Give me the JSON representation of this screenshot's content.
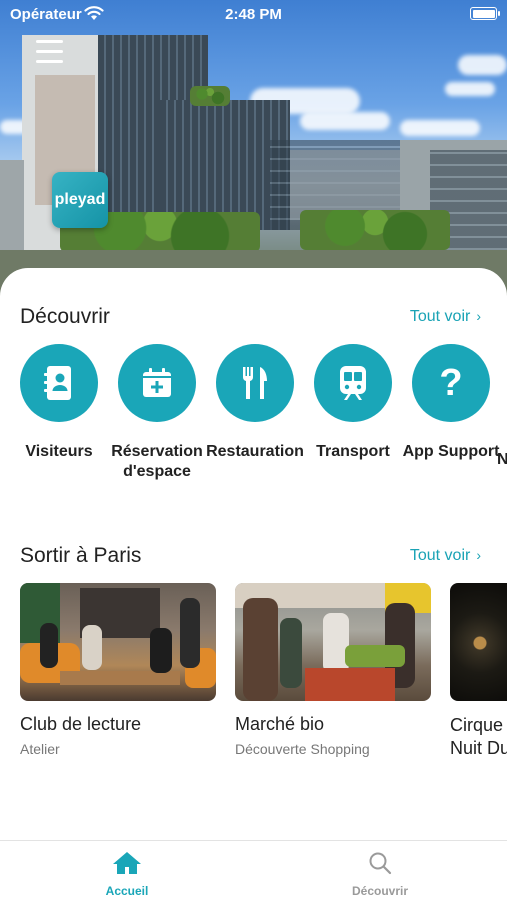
{
  "status_bar": {
    "carrier": "Opérateur",
    "time": "2:48 PM"
  },
  "brand": {
    "logo_text": "pleyad",
    "accent": "#1aa6b8"
  },
  "discover": {
    "title": "Découvrir",
    "see_all": "Tout voir",
    "categories": [
      {
        "label": "Visiteurs",
        "icon": "contact-book-icon"
      },
      {
        "label": "Réservation\nd'espace",
        "icon": "calendar-plus-icon"
      },
      {
        "label": "Restauration",
        "icon": "fork-knife-icon"
      },
      {
        "label": "Transport",
        "icon": "train-icon"
      },
      {
        "label": "App Support",
        "icon": "question-mark-icon"
      },
      {
        "label": "N",
        "icon": ""
      }
    ]
  },
  "outings": {
    "title": "Sortir à Paris",
    "see_all": "Tout voir",
    "events": [
      {
        "title": "Club de lecture",
        "subtitle": "Atelier"
      },
      {
        "title": "Marché bio",
        "subtitle": "Découverte Shopping"
      },
      {
        "title": "Cirque",
        "title2": "Nuit Du",
        "subtitle": ""
      }
    ]
  },
  "tab_bar": {
    "tabs": [
      {
        "label": "Accueil",
        "icon": "home-icon",
        "active": true
      },
      {
        "label": "Découvrir",
        "icon": "search-icon",
        "active": false
      }
    ]
  }
}
